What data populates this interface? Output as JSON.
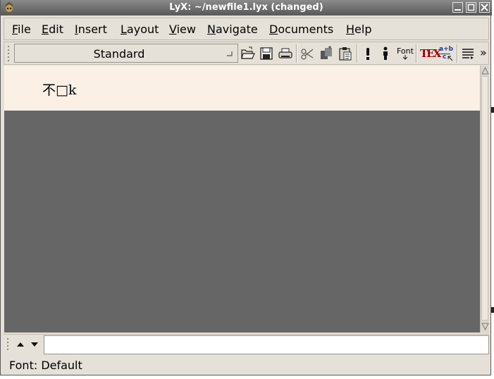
{
  "window": {
    "title": "LyX: ~/newfile1.lyx (changed)"
  },
  "menubar": {
    "items": [
      {
        "first": "F",
        "rest": "ile"
      },
      {
        "first": "E",
        "rest": "dit"
      },
      {
        "first": "I",
        "rest": "nsert"
      },
      {
        "first": "L",
        "rest": "ayout"
      },
      {
        "first": "V",
        "rest": "iew"
      },
      {
        "first": "N",
        "rest": "avigate"
      },
      {
        "first": "D",
        "rest": "ocuments"
      },
      {
        "first": "H",
        "rest": "elp"
      }
    ]
  },
  "toolbar": {
    "layout_value": "Standard",
    "font_label": "Font",
    "math_label_top": "a+b",
    "math_label_bottom": "c",
    "overflow": "»",
    "tex_label": "TEX"
  },
  "document": {
    "text": "不□k"
  },
  "statusbar": {
    "text": "Font: Default"
  }
}
